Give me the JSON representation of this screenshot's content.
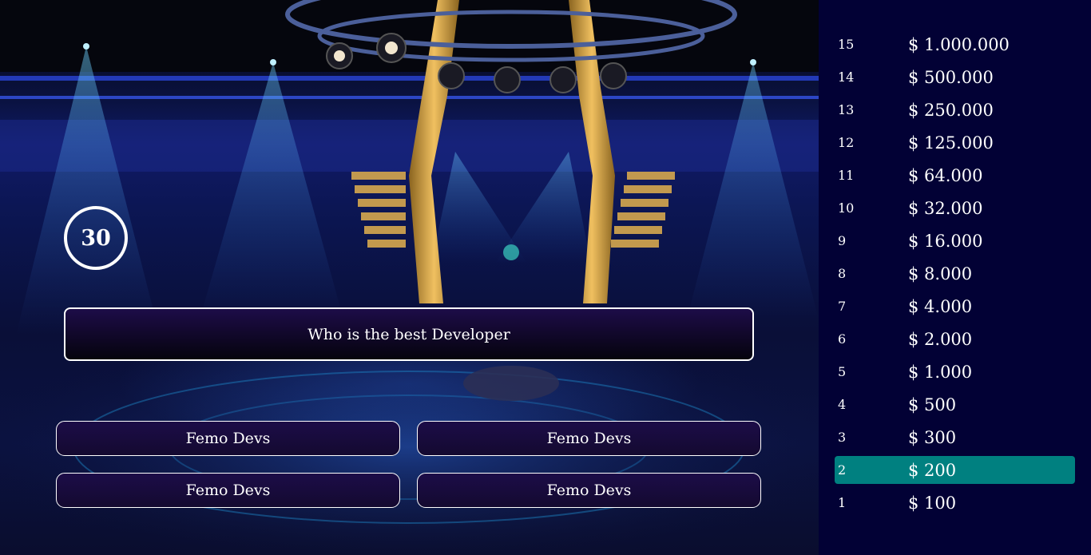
{
  "timer": {
    "value": "30"
  },
  "question": {
    "text": "Who is the best Developer"
  },
  "answers": [
    {
      "label": "Femo Devs"
    },
    {
      "label": "Femo Devs"
    },
    {
      "label": "Femo Devs"
    },
    {
      "label": "Femo Devs"
    }
  ],
  "ladder": {
    "active_level": "2",
    "active_color": "#008080",
    "levels": [
      {
        "num": "15",
        "amount": "$ 1.000.000"
      },
      {
        "num": "14",
        "amount": "$ 500.000"
      },
      {
        "num": "13",
        "amount": "$ 250.000"
      },
      {
        "num": "12",
        "amount": "$ 125.000"
      },
      {
        "num": "11",
        "amount": "$ 64.000"
      },
      {
        "num": "10",
        "amount": "$ 32.000"
      },
      {
        "num": "9",
        "amount": "$ 16.000"
      },
      {
        "num": "8",
        "amount": "$ 8.000"
      },
      {
        "num": "7",
        "amount": "$ 4.000"
      },
      {
        "num": "6",
        "amount": "$ 2.000"
      },
      {
        "num": "5",
        "amount": "$ 1.000"
      },
      {
        "num": "4",
        "amount": "$ 500"
      },
      {
        "num": "3",
        "amount": "$ 300"
      },
      {
        "num": "2",
        "amount": "$ 200"
      },
      {
        "num": "1",
        "amount": "$ 100"
      }
    ]
  }
}
